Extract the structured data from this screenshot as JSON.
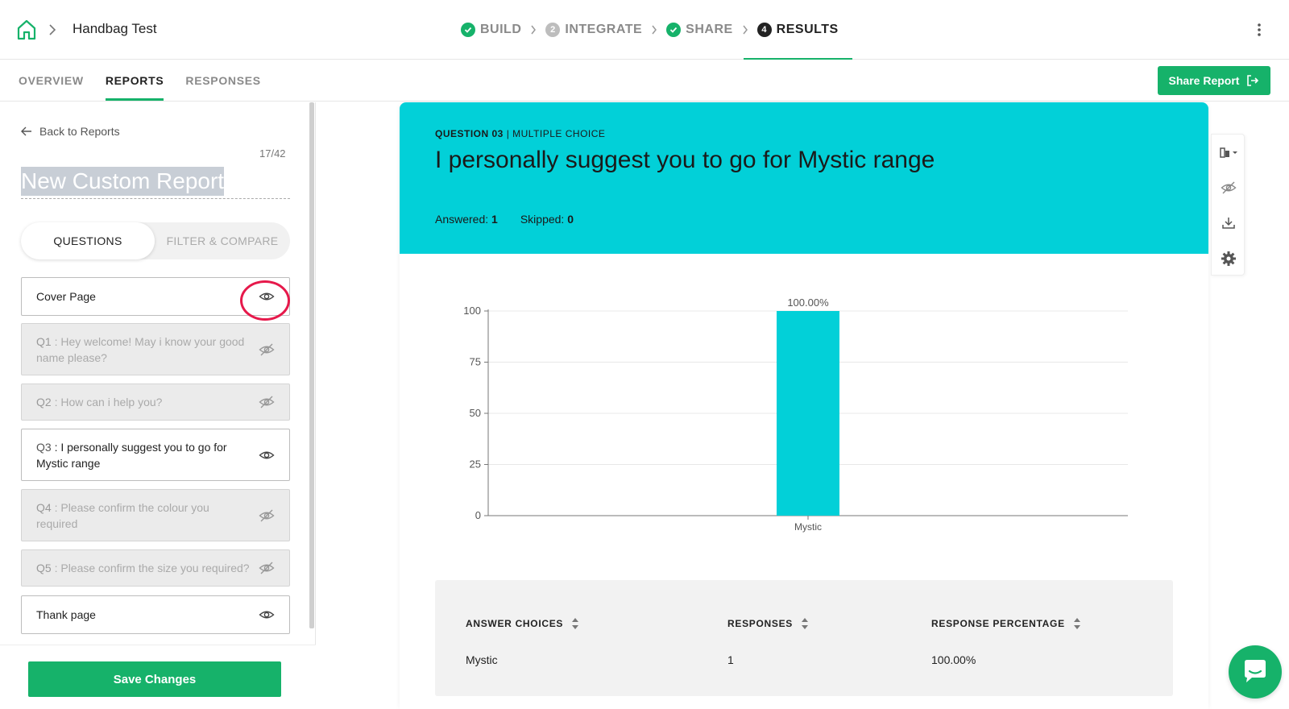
{
  "header": {
    "project_title": "Handbag Test",
    "steps": [
      {
        "label": "BUILD",
        "badge": "",
        "state": "done"
      },
      {
        "label": "INTEGRATE",
        "badge": "2",
        "state": "todo"
      },
      {
        "label": "SHARE",
        "badge": "",
        "state": "done"
      },
      {
        "label": "RESULTS",
        "badge": "4",
        "state": "active"
      }
    ],
    "icons": {
      "home": "home-icon",
      "menu": "kebab-menu-icon"
    }
  },
  "subnav": {
    "tabs": [
      "OVERVIEW",
      "REPORTS",
      "RESPONSES"
    ],
    "active_tab": "REPORTS",
    "share_label": "Share Report"
  },
  "sidebar": {
    "back_label": "Back to Reports",
    "count": "17/42",
    "report_title": "New Custom Report",
    "toggle": {
      "questions": "QUESTIONS",
      "filter": "FILTER & COMPARE"
    },
    "items": [
      {
        "num": "",
        "text": "Cover Page",
        "visible": true
      },
      {
        "num": "Q1",
        "text": " : Hey welcome! May i know your good name please?",
        "visible": false
      },
      {
        "num": "Q2",
        "text": " : How can i help you?",
        "visible": false
      },
      {
        "num": "Q3",
        "text": " : I personally suggest you to go for Mystic range",
        "visible": true
      },
      {
        "num": "Q4",
        "text": " : Please confirm the colour you required",
        "visible": false
      },
      {
        "num": "Q5",
        "text": " : Please confirm the size you required?",
        "visible": false
      },
      {
        "num": "",
        "text": "Thank page",
        "visible": true
      }
    ],
    "save_label": "Save Changes"
  },
  "question": {
    "number_label": "QUESTION 03",
    "type_label": " | MULTIPLE CHOICE",
    "title": "I personally suggest you to go for Mystic range",
    "answered_label": "Answered: ",
    "answered": "1",
    "skipped_label": "Skipped: ",
    "skipped": "0"
  },
  "chart_data": {
    "type": "bar",
    "categories": [
      "Mystic"
    ],
    "values": [
      100
    ],
    "data_labels": [
      "100.00%"
    ],
    "yticks": [
      0,
      25,
      50,
      75,
      100
    ],
    "ylim": [
      0,
      100
    ],
    "grid": true,
    "title": "",
    "xlabel": "",
    "ylabel": "",
    "bar_color": "#02d0d8"
  },
  "table": {
    "headers": [
      "ANSWER CHOICES",
      "RESPONSES",
      "RESPONSE PERCENTAGE"
    ],
    "rows": [
      [
        "Mystic",
        "1",
        "100.00%"
      ]
    ]
  },
  "tools": [
    "chart-type-icon",
    "hide-icon",
    "download-icon",
    "settings-icon"
  ],
  "colors": {
    "accent": "#16b26a",
    "header_bg": "#02d0d8",
    "highlight": "#e6194b"
  }
}
